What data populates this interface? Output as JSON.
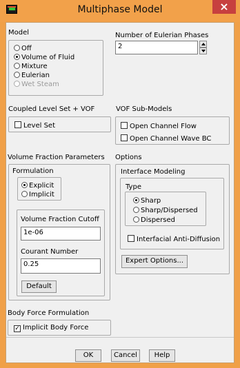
{
  "window": {
    "title": "Multiphase Model",
    "close_glyph": "×"
  },
  "model": {
    "label": "Model",
    "options": [
      {
        "label": "Off",
        "selected": false,
        "enabled": true
      },
      {
        "label": "Volume of Fluid",
        "selected": true,
        "enabled": true
      },
      {
        "label": "Mixture",
        "selected": false,
        "enabled": true
      },
      {
        "label": "Eulerian",
        "selected": false,
        "enabled": true
      },
      {
        "label": "Wet Steam",
        "selected": false,
        "enabled": false
      }
    ]
  },
  "eulerian_phases": {
    "label": "Number of Eulerian Phases",
    "value": "2"
  },
  "coupled": {
    "label": "Coupled Level Set + VOF",
    "level_set": {
      "label": "Level Set",
      "checked": false
    }
  },
  "vof_submodels": {
    "label": "VOF Sub-Models",
    "open_channel_flow": {
      "label": "Open Channel Flow",
      "checked": false
    },
    "open_channel_wave_bc": {
      "label": "Open Channel Wave BC",
      "checked": false
    }
  },
  "vf_params": {
    "label": "Volume Fraction Parameters",
    "formulation": {
      "label": "Formulation",
      "options": [
        {
          "label": "Explicit",
          "selected": true
        },
        {
          "label": "Implicit",
          "selected": false
        }
      ]
    },
    "cutoff": {
      "label": "Volume Fraction Cutoff",
      "value": "1e-06"
    },
    "courant": {
      "label": "Courant Number",
      "value": "0.25"
    },
    "default_button": "Default"
  },
  "options": {
    "label": "Options",
    "interface_modeling": {
      "label": "Interface Modeling",
      "type_label": "Type",
      "types": [
        {
          "label": "Sharp",
          "selected": true
        },
        {
          "label": "Sharp/Dispersed",
          "selected": false
        },
        {
          "label": "Dispersed",
          "selected": false
        }
      ],
      "anti_diffusion": {
        "label": "Interfacial Anti-Diffusion",
        "checked": false
      }
    },
    "expert_button": "Expert Options..."
  },
  "body_force": {
    "label": "Body Force Formulation",
    "implicit": {
      "label": "Implicit Body Force",
      "checked": true
    }
  },
  "buttons": {
    "ok": "OK",
    "cancel": "Cancel",
    "help": "Help"
  }
}
